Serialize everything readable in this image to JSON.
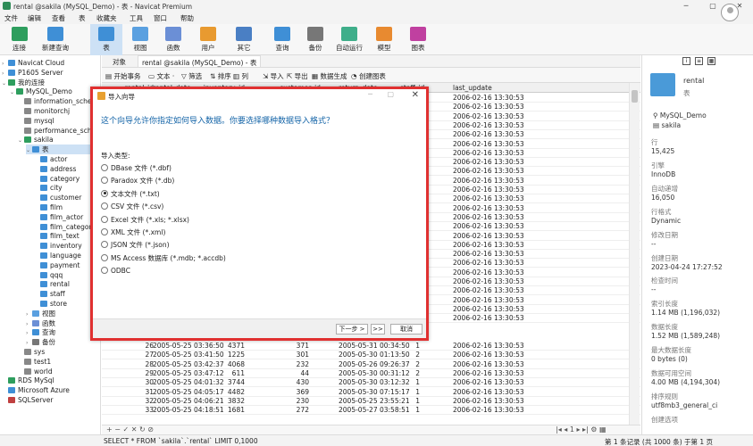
{
  "window": {
    "title": "rental @sakila (MySQL_Demo) - 表 - Navicat Premium",
    "min": "─",
    "max": "▢",
    "close": "✕"
  },
  "menu": [
    "文件",
    "编辑",
    "查看",
    "表",
    "收藏夹",
    "工具",
    "窗口",
    "帮助"
  ],
  "toolbar": [
    {
      "label": "连接",
      "icon": "plug-icon",
      "color": "#2e9e5e"
    },
    {
      "label": "新建查询",
      "icon": "new-query-icon",
      "color": "#3f8fd6"
    },
    {
      "label": "表",
      "icon": "table-icon",
      "color": "#3f8fd6"
    },
    {
      "label": "视图",
      "icon": "view-icon",
      "color": "#5aa0e0"
    },
    {
      "label": "函数",
      "icon": "function-icon",
      "color": "#6b8fd6"
    },
    {
      "label": "用户",
      "icon": "user-icon",
      "color": "#e89a30"
    },
    {
      "label": "其它",
      "icon": "tools-icon",
      "color": "#4a7fc4"
    },
    {
      "label": "查询",
      "icon": "query-icon",
      "color": "#3f8fd6"
    },
    {
      "label": "备份",
      "icon": "backup-icon",
      "color": "#777777"
    },
    {
      "label": "自动运行",
      "icon": "robot-icon",
      "color": "#3fae8a"
    },
    {
      "label": "模型",
      "icon": "model-icon",
      "color": "#e88a30"
    },
    {
      "label": "图表",
      "icon": "chart-icon",
      "color": "#c040a0"
    }
  ],
  "sidebar": [
    {
      "label": "Navicat Cloud",
      "level": 0,
      "arrow": "›",
      "color": "#3f8fd6"
    },
    {
      "label": "P1605 Server",
      "level": 0,
      "arrow": "›",
      "color": "#3f8fd6"
    },
    {
      "label": "我的连接",
      "level": 0,
      "arrow": "⌄",
      "color": "#2e9e5e"
    },
    {
      "label": "MySQL_Demo",
      "level": 1,
      "arrow": "⌄",
      "color": "#2e9e5e"
    },
    {
      "label": "information_schema",
      "level": 2,
      "arrow": "",
      "color": "#888888"
    },
    {
      "label": "monitorchj",
      "level": 2,
      "arrow": "",
      "color": "#888888"
    },
    {
      "label": "mysql",
      "level": 2,
      "arrow": "",
      "color": "#888888"
    },
    {
      "label": "performance_schema",
      "level": 2,
      "arrow": "",
      "color": "#888888"
    },
    {
      "label": "sakila",
      "level": 2,
      "arrow": "⌄",
      "color": "#2e9e5e"
    },
    {
      "label": "表",
      "level": 3,
      "arrow": "⌄",
      "color": "#3f8fd6",
      "selected": true
    },
    {
      "label": "actor",
      "level": 4,
      "arrow": "",
      "color": "#3f8fd6"
    },
    {
      "label": "address",
      "level": 4,
      "arrow": "",
      "color": "#3f8fd6"
    },
    {
      "label": "category",
      "level": 4,
      "arrow": "",
      "color": "#3f8fd6"
    },
    {
      "label": "city",
      "level": 4,
      "arrow": "",
      "color": "#3f8fd6"
    },
    {
      "label": "customer",
      "level": 4,
      "arrow": "",
      "color": "#3f8fd6"
    },
    {
      "label": "film",
      "level": 4,
      "arrow": "",
      "color": "#3f8fd6"
    },
    {
      "label": "film_actor",
      "level": 4,
      "arrow": "",
      "color": "#3f8fd6"
    },
    {
      "label": "film_category",
      "level": 4,
      "arrow": "",
      "color": "#3f8fd6"
    },
    {
      "label": "film_text",
      "level": 4,
      "arrow": "",
      "color": "#3f8fd6"
    },
    {
      "label": "inventory",
      "level": 4,
      "arrow": "",
      "color": "#3f8fd6"
    },
    {
      "label": "language",
      "level": 4,
      "arrow": "",
      "color": "#3f8fd6"
    },
    {
      "label": "payment",
      "level": 4,
      "arrow": "",
      "color": "#3f8fd6"
    },
    {
      "label": "qqq",
      "level": 4,
      "arrow": "",
      "color": "#3f8fd6"
    },
    {
      "label": "rental",
      "level": 4,
      "arrow": "",
      "color": "#3f8fd6"
    },
    {
      "label": "staff",
      "level": 4,
      "arrow": "",
      "color": "#3f8fd6"
    },
    {
      "label": "store",
      "level": 4,
      "arrow": "",
      "color": "#3f8fd6"
    },
    {
      "label": "视图",
      "level": 3,
      "arrow": "›",
      "color": "#5aa0e0"
    },
    {
      "label": "函数",
      "level": 3,
      "arrow": "›",
      "color": "#6b8fd6"
    },
    {
      "label": "查询",
      "level": 3,
      "arrow": "›",
      "color": "#3f8fd6"
    },
    {
      "label": "备份",
      "level": 3,
      "arrow": "›",
      "color": "#777777"
    },
    {
      "label": "sys",
      "level": 2,
      "arrow": "",
      "color": "#888888"
    },
    {
      "label": "test1",
      "level": 2,
      "arrow": "",
      "color": "#888888"
    },
    {
      "label": "world",
      "level": 2,
      "arrow": "",
      "color": "#888888"
    },
    {
      "label": "RDS MySql",
      "level": 0,
      "arrow": "",
      "color": "#2e9e5e"
    },
    {
      "label": "Microsoft Azure",
      "level": 0,
      "arrow": "",
      "color": "#3f8fd6"
    },
    {
      "label": "SQLServer",
      "level": 0,
      "arrow": "",
      "color": "#c04040"
    }
  ],
  "objtabs": {
    "objects": "对象",
    "active": "rental @sakila (MySQL_Demo) - 表"
  },
  "gridtool": {
    "begin": "开始事务",
    "text": "文本 ·",
    "filter": "筛选",
    "sort": "排序",
    "columns": "列",
    "import": "导入",
    "export": "导出",
    "datagen": "数据生成",
    "createchart": "创建图表"
  },
  "grid": {
    "columns": [
      "rental_id",
      "rental_date",
      "inventory_id",
      "customer_id",
      "return_date",
      "staff_id",
      "last_update"
    ],
    "top_rows": [
      [
        "",
        "",
        "",
        "",
        "",
        "",
        "2006-02-16 13:30:53"
      ],
      [
        "",
        "",
        "",
        "",
        "",
        "",
        "2006-02-16 13:30:53"
      ],
      [
        "",
        "",
        "",
        "",
        "",
        "",
        "2006-02-16 13:30:53"
      ],
      [
        "",
        "",
        "",
        "",
        "",
        "",
        "2006-02-16 13:30:53"
      ],
      [
        "",
        "",
        "",
        "",
        "",
        "",
        "2006-02-16 13:30:53"
      ],
      [
        "",
        "",
        "",
        "",
        "",
        "",
        "2006-02-16 13:30:53"
      ],
      [
        "",
        "",
        "",
        "",
        "",
        "",
        "2006-02-16 13:30:53"
      ],
      [
        "",
        "",
        "",
        "",
        "",
        "",
        "2006-02-16 13:30:53"
      ],
      [
        "",
        "",
        "",
        "",
        "",
        "",
        "2006-02-16 13:30:53"
      ],
      [
        "",
        "",
        "",
        "",
        "",
        "",
        "2006-02-16 13:30:53"
      ],
      [
        "",
        "",
        "",
        "",
        "",
        "",
        "2006-02-16 13:30:53"
      ],
      [
        "",
        "",
        "",
        "",
        "",
        "",
        "2006-02-16 13:30:53"
      ],
      [
        "",
        "",
        "",
        "",
        "",
        "",
        "2006-02-16 13:30:53"
      ],
      [
        "",
        "",
        "",
        "",
        "",
        "",
        "2006-02-16 13:30:53"
      ],
      [
        "",
        "",
        "",
        "",
        "",
        "",
        "2006-02-16 13:30:53"
      ],
      [
        "",
        "",
        "",
        "",
        "",
        "",
        "2006-02-16 13:30:53"
      ],
      [
        "",
        "",
        "",
        "",
        "",
        "",
        "2006-02-16 13:30:53"
      ],
      [
        "",
        "",
        "",
        "",
        "",
        "",
        "2006-02-16 13:30:53"
      ],
      [
        "",
        "",
        "",
        "",
        "",
        "",
        "2006-02-16 13:30:53"
      ],
      [
        "",
        "",
        "",
        "",
        "",
        "",
        "2006-02-16 13:30:53"
      ],
      [
        "",
        "",
        "",
        "",
        "",
        "",
        "2006-02-16 13:30:53"
      ],
      [
        "",
        "",
        "",
        "",
        "",
        "",
        "2006-02-16 13:30:53"
      ],
      [
        "",
        "",
        "",
        "",
        "",
        "",
        "2006-02-16 13:30:53"
      ],
      [
        "",
        "",
        "",
        "",
        "",
        "",
        "2006-02-16 13:30:53"
      ],
      [
        "",
        "",
        "",
        "",
        "",
        "",
        "2006-02-16 13:30:53"
      ]
    ],
    "bottom_rows": [
      [
        "26",
        "2005-05-25 03:36:50",
        "4371",
        "371",
        "2005-05-31 00:34:50",
        "1",
        "2006-02-16 13:30:53"
      ],
      [
        "27",
        "2005-05-25 03:41:50",
        "1225",
        "301",
        "2005-05-30 01:13:50",
        "2",
        "2006-02-16 13:30:53"
      ],
      [
        "28",
        "2005-05-25 03:42:37",
        "4068",
        "232",
        "2005-05-26 09:26:37",
        "2",
        "2006-02-16 13:30:53"
      ],
      [
        "29",
        "2005-05-25 03:47:12",
        "611",
        "44",
        "2005-05-30 00:31:12",
        "2",
        "2006-02-16 13:30:53"
      ],
      [
        "30",
        "2005-05-25 04:01:32",
        "3744",
        "430",
        "2005-05-30 03:12:32",
        "1",
        "2006-02-16 13:30:53"
      ],
      [
        "31",
        "2005-05-25 04:05:17",
        "4482",
        "369",
        "2005-05-30 07:15:17",
        "1",
        "2006-02-16 13:30:53"
      ],
      [
        "32",
        "2005-05-25 04:06:21",
        "3832",
        "230",
        "2005-05-25 23:55:21",
        "1",
        "2006-02-16 13:30:53"
      ],
      [
        "33",
        "2005-05-25 04:18:51",
        "1681",
        "272",
        "2005-05-27 03:58:51",
        "1",
        "2006-02-16 13:30:53"
      ]
    ]
  },
  "gridnav": {
    "left": "+ − ✓ ✕ ↻ ⊘",
    "right": "|◂ ◂ 1 ▸ ▸| ⚙ ▦"
  },
  "status": {
    "sql": "SELECT * FROM `sakila`.`rental` LIMIT 0,1000",
    "record": "第 1 条记录 (共 1000 条) 于第 1 页"
  },
  "rpanel": {
    "name": "rental",
    "type": "表",
    "conn": "MySQL_Demo",
    "db": "sakila",
    "props": [
      {
        "label": "行",
        "value": "15,425"
      },
      {
        "label": "引擎",
        "value": "InnoDB"
      },
      {
        "label": "自动递增",
        "value": "16,050"
      },
      {
        "label": "行格式",
        "value": "Dynamic"
      },
      {
        "label": "修改日期",
        "value": "--"
      },
      {
        "label": "创建日期",
        "value": "2023-04-24 17:27:52"
      },
      {
        "label": "检查时间",
        "value": "--"
      },
      {
        "label": "索引长度",
        "value": "1.14 MB (1,196,032)"
      },
      {
        "label": "数据长度",
        "value": "1.52 MB (1,589,248)"
      },
      {
        "label": "最大数据长度",
        "value": "0 bytes (0)"
      },
      {
        "label": "数据可用空间",
        "value": "4.00 MB (4,194,304)"
      },
      {
        "label": "排序规则",
        "value": "utf8mb3_general_ci"
      },
      {
        "label": "创建选项",
        "value": ""
      }
    ]
  },
  "dialog": {
    "title": "导入向导",
    "heading": "这个向导允许你指定如何导入数据。你要选择哪种数据导入格式？",
    "subtitle": "导入类型:",
    "options": [
      {
        "label": "DBase 文件 (*.dbf)",
        "checked": false
      },
      {
        "label": "Paradox 文件 (*.db)",
        "checked": false
      },
      {
        "label": "文本文件 (*.txt)",
        "checked": true
      },
      {
        "label": "CSV 文件 (*.csv)",
        "checked": false
      },
      {
        "label": "Excel 文件 (*.xls; *.xlsx)",
        "checked": false
      },
      {
        "label": "XML 文件 (*.xml)",
        "checked": false
      },
      {
        "label": "JSON 文件 (*.json)",
        "checked": false
      },
      {
        "label": "MS Access 数据库 (*.mdb; *.accdb)",
        "checked": false
      },
      {
        "label": "ODBC",
        "checked": false
      }
    ],
    "next": "下一步 >",
    "last": ">>",
    "cancel": "取消"
  }
}
